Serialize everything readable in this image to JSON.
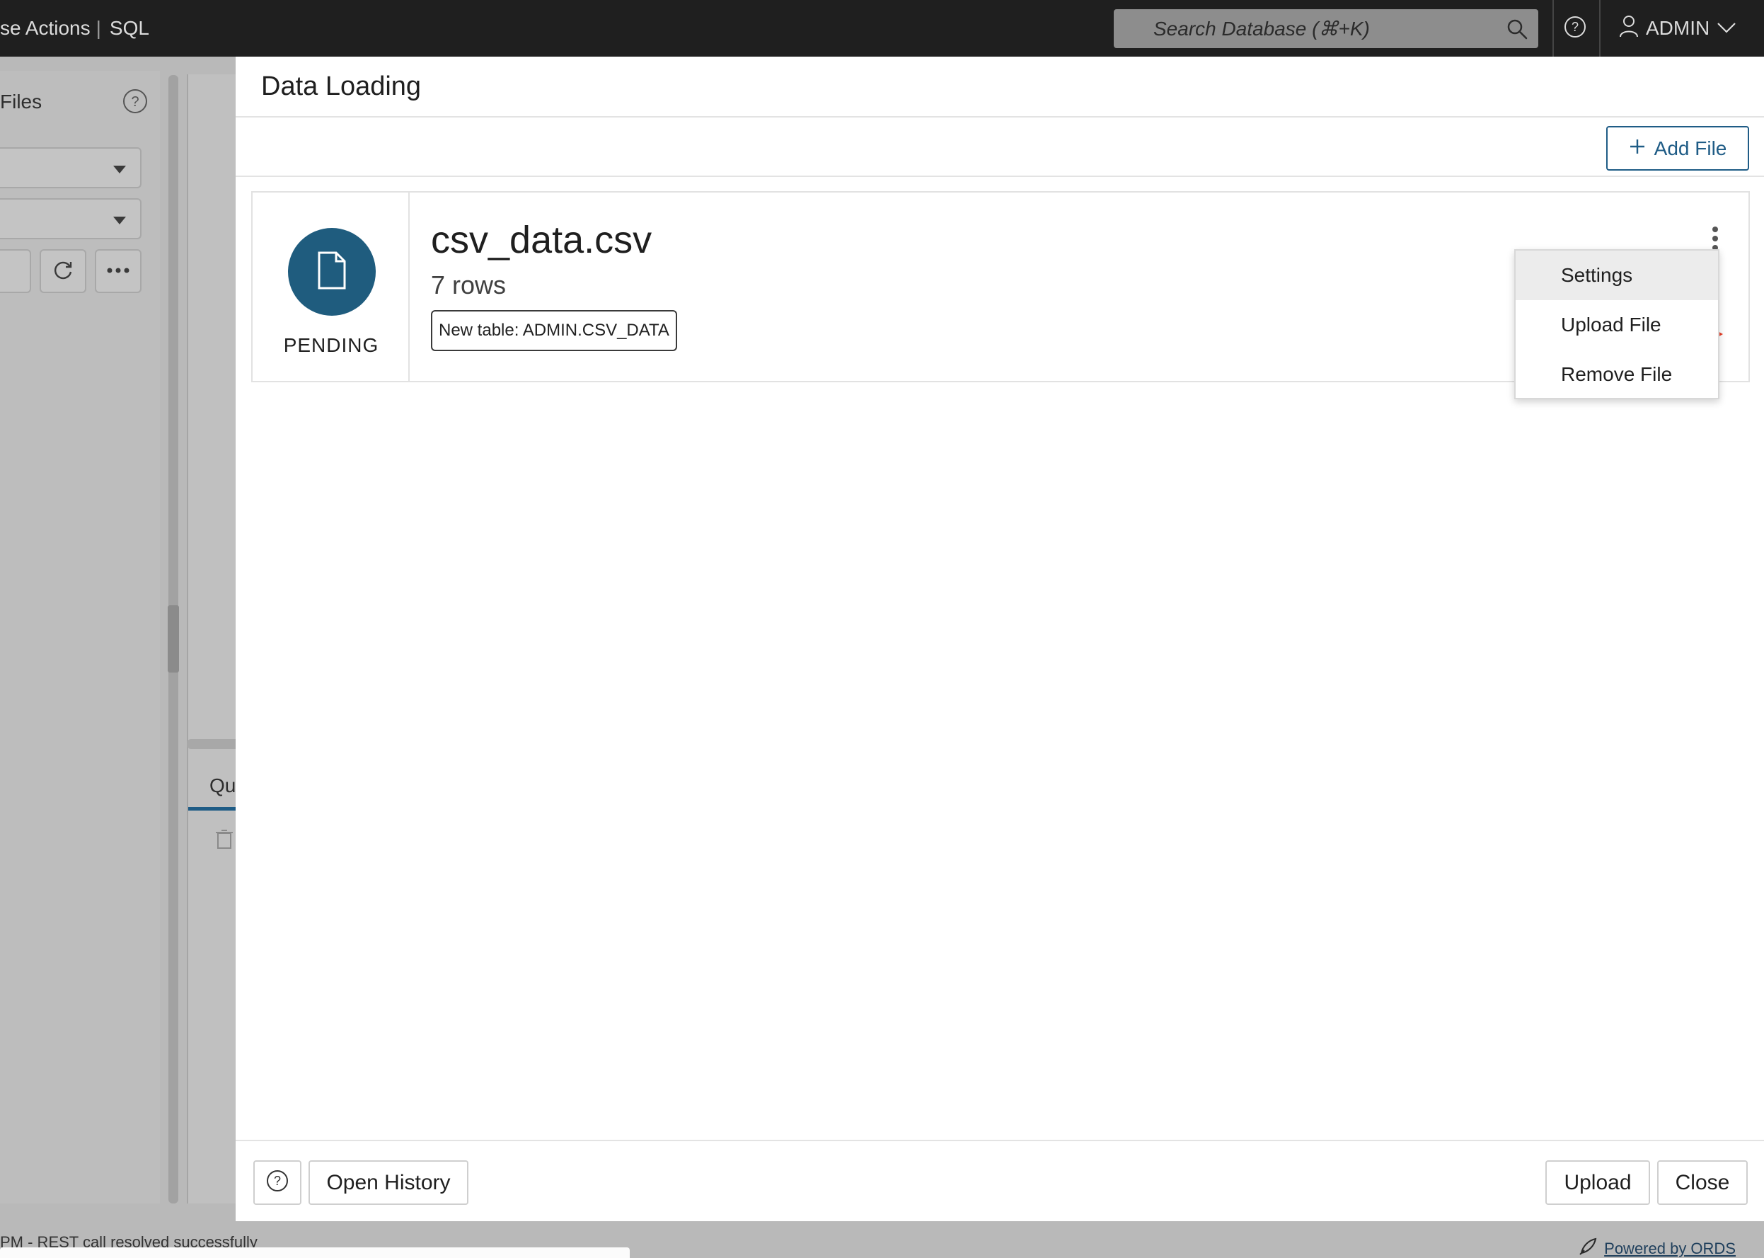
{
  "topbar": {
    "brand_prefix": "se Actions",
    "brand_separator": "|",
    "brand_suffix": "SQL",
    "search_placeholder": "Search Database (⌘+K)",
    "user_label": "ADMIN",
    "icons": [
      "search-icon",
      "help-icon",
      "user-icon",
      "chevron-down-icon"
    ]
  },
  "background": {
    "panel_title": "Files",
    "tab_label": "Qu",
    "status_text": "PM - REST call resolved successfully",
    "footer_link": "Powered by ORDS"
  },
  "modal": {
    "title": "Data Loading",
    "add_file_label": "Add File",
    "file": {
      "status": "PENDING",
      "name": "csv_data.csv",
      "rows": "7 rows",
      "table_chip": "New table: ADMIN.CSV_DATA"
    },
    "menu": {
      "items": [
        {
          "label": "Settings",
          "active": true
        },
        {
          "label": "Upload File",
          "active": false
        },
        {
          "label": "Remove File",
          "active": false
        }
      ]
    },
    "footer": {
      "open_history_label": "Open History",
      "upload_label": "Upload",
      "close_label": "Close"
    }
  },
  "colors": {
    "accent": "#1f5c86",
    "file_circle": "#1f5c7e",
    "annotation_arrow": "#e8402a",
    "topbar_bg": "#1f1f1f"
  }
}
